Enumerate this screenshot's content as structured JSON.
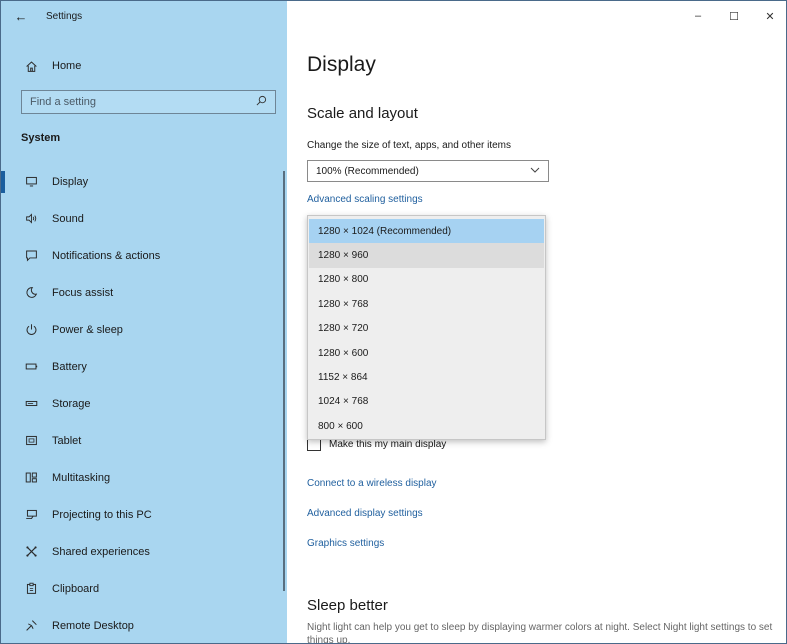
{
  "window": {
    "title": "Settings",
    "controls": {
      "minimize": "–",
      "maximize": "☐",
      "close": "✕"
    }
  },
  "sidebar": {
    "home_label": "Home",
    "search_placeholder": "Find a setting",
    "section_label": "System",
    "items": [
      {
        "label": "Display",
        "icon": "monitor-icon",
        "selected": true
      },
      {
        "label": "Sound",
        "icon": "speaker-icon"
      },
      {
        "label": "Notifications & actions",
        "icon": "notification-icon"
      },
      {
        "label": "Focus assist",
        "icon": "moon-icon"
      },
      {
        "label": "Power & sleep",
        "icon": "power-icon"
      },
      {
        "label": "Battery",
        "icon": "battery-icon"
      },
      {
        "label": "Storage",
        "icon": "storage-icon"
      },
      {
        "label": "Tablet",
        "icon": "tablet-icon"
      },
      {
        "label": "Multitasking",
        "icon": "multitasking-icon"
      },
      {
        "label": "Projecting to this PC",
        "icon": "projecting-icon"
      },
      {
        "label": "Shared experiences",
        "icon": "shared-icon"
      },
      {
        "label": "Clipboard",
        "icon": "clipboard-icon"
      },
      {
        "label": "Remote Desktop",
        "icon": "remote-desktop-icon"
      }
    ]
  },
  "main": {
    "page_title": "Display",
    "scale_heading": "Scale and layout",
    "scale_description": "Change the size of text, apps, and other items",
    "scale_value": "100% (Recommended)",
    "advanced_scaling_link": "Advanced scaling settings",
    "resolution_options": [
      "1280 × 1024 (Recommended)",
      "1280 × 960",
      "1280 × 800",
      "1280 × 768",
      "1280 × 720",
      "1280 × 600",
      "1152 × 864",
      "1024 × 768",
      "800 × 600"
    ],
    "main_display_checkbox": "Make this my main display",
    "wireless_link": "Connect to a wireless display",
    "advanced_display_link": "Advanced display settings",
    "graphics_link": "Graphics settings",
    "sleep_heading": "Sleep better",
    "sleep_description": "Night light can help you get to sleep by displaying warmer colors at night. Select Night light settings to set things up."
  },
  "colors": {
    "sidebar_bg": "#a9d6f0",
    "link": "#1f5f9e",
    "selected_option": "#a6d2f2",
    "selection_bar": "#1a5e9e"
  }
}
